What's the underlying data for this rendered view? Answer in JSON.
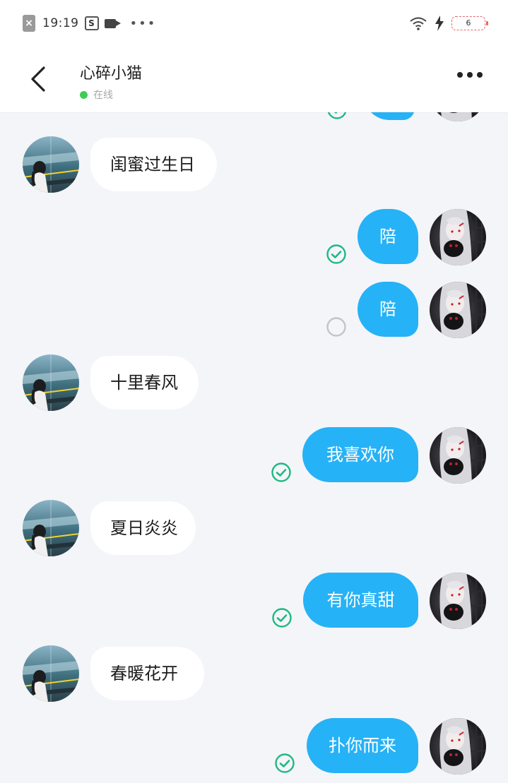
{
  "status_bar": {
    "time": "19:19",
    "battery": "6",
    "left_icons": [
      "close-notification-icon",
      "s-app-icon",
      "video-camera-icon",
      "more-dots-icon"
    ],
    "right_icons": [
      "wifi-icon",
      "charging-bolt-icon",
      "battery-icon"
    ]
  },
  "header": {
    "title": "心碎小猫",
    "status_text": "在线",
    "status_color": "#3dcc56"
  },
  "colors": {
    "outgoing_bubble": "#26b2f6",
    "incoming_bubble": "#ffffff",
    "read_check": "#1fb981",
    "pending_check": "#c4c4c4",
    "background": "#f4f5f9"
  },
  "messages": [
    {
      "direction": "in",
      "text": "闺蜜过生日"
    },
    {
      "direction": "out",
      "text": "陪",
      "status": "read"
    },
    {
      "direction": "out",
      "text": "陪",
      "status": "pending"
    },
    {
      "direction": "in",
      "text": "十里春风"
    },
    {
      "direction": "out",
      "text": "我喜欢你",
      "status": "read"
    },
    {
      "direction": "in",
      "text": "夏日炎炎"
    },
    {
      "direction": "out",
      "text": "有你真甜",
      "status": "read"
    },
    {
      "direction": "in",
      "text": "春暖花开"
    },
    {
      "direction": "out",
      "text": "扑你而来",
      "status": "read"
    }
  ]
}
